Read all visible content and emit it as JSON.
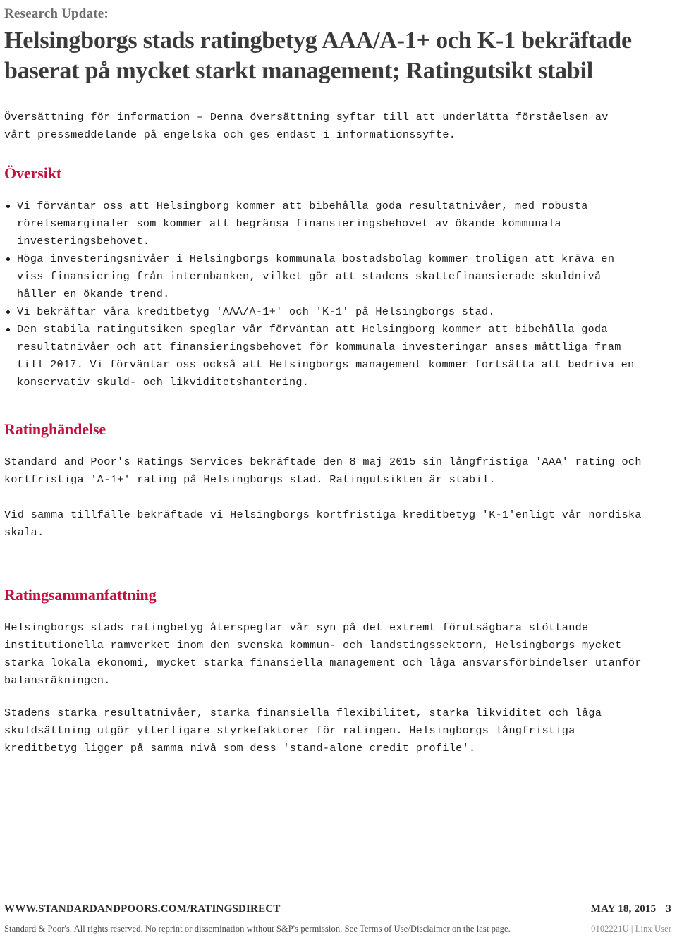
{
  "header": {
    "kicker": "Research Update:",
    "title": "Helsingborgs stads ratingbetyg AAA/A-1+ och K-1 bekräftade baserat på mycket starkt management; Ratingutsikt stabil",
    "accent_color": "#c3113f",
    "kicker_color": "#6e6e6e",
    "title_color": "#3a3a3a"
  },
  "intro": {
    "text": "Översättning för information – Denna översättning syftar till att underlätta förståelsen av vårt pressmeddelande på engelska och ges endast i informationssyfte."
  },
  "sections": {
    "overview": {
      "heading": "Översikt",
      "bullets": [
        "Vi förväntar oss att Helsingborg kommer att bibehålla goda resultatnivåer, med robusta rörelsemarginaler som kommer att begränsa finansieringsbehovet av ökande kommunala investeringsbehovet.",
        "Höga investeringsnivåer i Helsingborgs kommunala bostadsbolag kommer troligen att kräva en viss finansiering från internbanken, vilket gör att stadens skattefinansierade skuldnivå håller en ökande trend.",
        "Vi bekräftar våra kreditbetyg 'AAA/A-1+' och 'K-1' på Helsingborgs stad.",
        "Den stabila ratingutsiken speglar vår förväntan att Helsingborg kommer att bibehålla goda resultatnivåer och att finansieringsbehovet för kommunala investeringar anses måttliga fram till 2017. Vi förväntar oss också att Helsingborgs management kommer fortsätta att bedriva en konservativ skuld- och likviditetshantering."
      ]
    },
    "rating_action": {
      "heading": "Ratinghändelse",
      "paragraphs": [
        "Standard and Poor's Ratings Services bekräftade den 8 maj 2015 sin långfristiga 'AAA' rating och kortfristiga 'A-1+' rating på Helsingborgs stad. Ratingutsikten är stabil.",
        "Vid samma tillfälle bekräftade vi Helsingborgs kortfristiga kreditbetyg 'K-1'enligt vår nordiska skala."
      ]
    },
    "rating_summary": {
      "heading": "Ratingsammanfattning",
      "paragraphs": [
        "Helsingborgs stads ratingbetyg återspeglar vår syn på det extremt förutsägbara stöttande institutionella ramverket inom den svenska kommun- och landstingssektorn, Helsingborgs mycket starka lokala ekonomi, mycket starka finansiella management och låga ansvarsförbindelser utanför balansräkningen.",
        "Stadens starka resultatnivåer, starka finansiella flexibilitet, starka likviditet och låga skuldsättning utgör ytterligare styrkefaktorer för ratingen. Helsingborgs långfristiga kreditbetyg ligger på samma nivå som dess 'stand-alone credit profile'."
      ]
    }
  },
  "footer": {
    "site_url": "WWW.STANDARDANDPOORS.COM/RATINGSDIRECT",
    "date": "MAY 18, 2015",
    "page_number": "3",
    "disclaimer": "Standard & Poor's. All rights reserved. No reprint or dissemination without S&P's permission. See Terms of Use/Disclaimer on the last page.",
    "document_id": "0102221U | Linx User"
  }
}
